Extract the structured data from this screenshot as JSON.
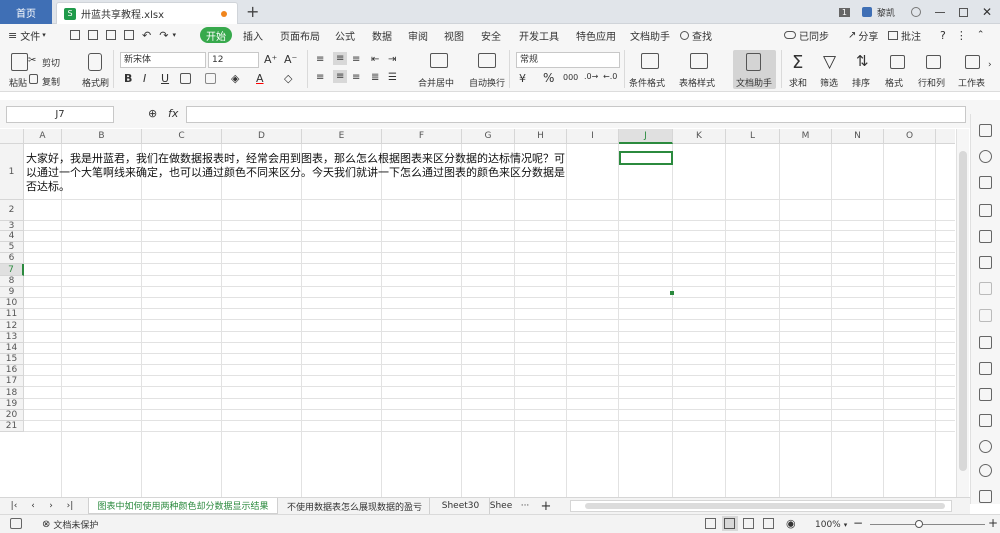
{
  "titlebar": {
    "home_tab": "首页",
    "doc_tab": "卅蓝共享教程.xlsx",
    "doc_icon": "S",
    "new_tab": "+",
    "window_count": "1",
    "user_name": "黎凯"
  },
  "menubar": {
    "file": "文件",
    "items": [
      "开始",
      "插入",
      "页面布局",
      "公式",
      "数据",
      "审阅",
      "视图",
      "安全",
      "开发工具",
      "特色应用",
      "文档助手"
    ],
    "search": "查找",
    "sync": "已同步",
    "share": "分享",
    "comment": "批注"
  },
  "ribbon": {
    "paste": "粘贴",
    "cut": "剪切",
    "copy": "复制",
    "format_painter": "格式刷",
    "font_name": "新宋体",
    "font_size": "12",
    "bold": "B",
    "italic": "I",
    "underline": "U",
    "merge_center": "合并居中",
    "wrap_text": "自动换行",
    "number_format": "常规",
    "percent": "%",
    "thousands": "000",
    "cond_format": "条件格式",
    "table_style": "表格样式",
    "doc_assistant": "文档助手",
    "sum": "求和",
    "filter": "筛选",
    "sort": "排序",
    "format": "格式",
    "row_col": "行和列",
    "worksheet": "工作表"
  },
  "formula_bar": {
    "name_box": "J7",
    "fx": "fx",
    "value": ""
  },
  "grid": {
    "columns": [
      "A",
      "B",
      "C",
      "D",
      "E",
      "F",
      "G",
      "H",
      "I",
      "J",
      "K",
      "L",
      "M",
      "N",
      "O"
    ],
    "rows": [
      "1",
      "2",
      "3",
      "4",
      "5",
      "6",
      "7",
      "8",
      "9",
      "10",
      "11",
      "12",
      "13",
      "14",
      "15",
      "16",
      "17",
      "18",
      "19",
      "20",
      "21"
    ],
    "cell_a1": "大家好，我是卅蓝君，我们在做数据报表时，经常会用到图表，那么怎么根据图表来区分数据的达标情况呢？可以通过一个大笔啊线来确定，也可以通过颜色不同来区分。今天我们就讲一下怎么通过图表的颜色来区分数据是否达标。",
    "selected_cell": "J7"
  },
  "sheets": {
    "tabs": [
      "图表中如何使用两种颜色却分数据显示结果",
      "不使用数据表怎么展现数据的盈亏",
      "Sheet30",
      "Shee"
    ],
    "more": "···",
    "add": "+"
  },
  "statusbar": {
    "protect": "文档未保护",
    "zoom": "100%",
    "zoom_minus": "−",
    "zoom_plus": "+"
  },
  "colors": {
    "accent_green": "#37a94c",
    "home_blue": "#3f6fb5",
    "selection_green": "#2b8a3e"
  }
}
